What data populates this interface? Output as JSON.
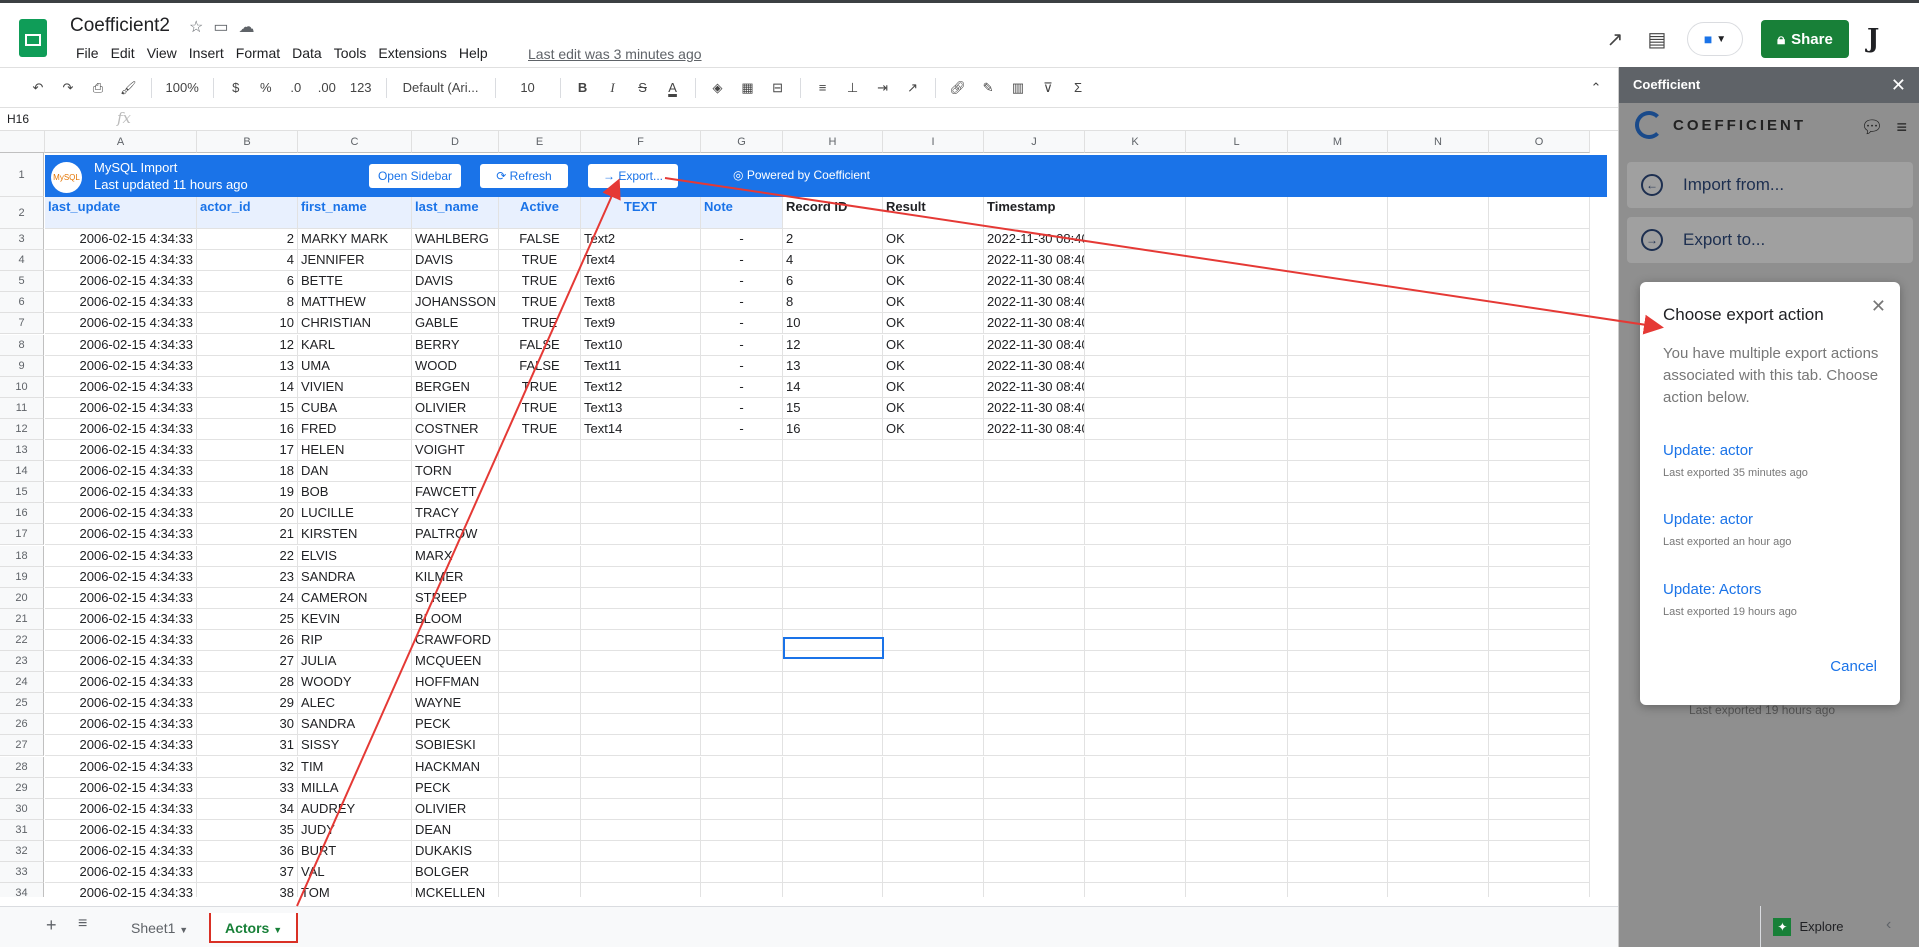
{
  "app": {
    "title": "Coefficient2",
    "menu": [
      "File",
      "Edit",
      "View",
      "Insert",
      "Format",
      "Data",
      "Tools",
      "Extensions",
      "Help"
    ],
    "last_edit": "Last edit was 3 minutes ago",
    "share_label": "Share",
    "avatar_letter": "J"
  },
  "toolbar": {
    "zoom": "100%",
    "currency": "$",
    "percent": "%",
    "dec_less": ".0",
    "dec_more": ".00",
    "format_more": "123",
    "font": "Default (Ari...",
    "font_size": "10",
    "bold": "B",
    "italic": "I",
    "strike": "S",
    "underline_a": "A"
  },
  "formula_bar": {
    "name_box": "H16",
    "fx": "fx"
  },
  "columns": [
    "A",
    "B",
    "C",
    "D",
    "E",
    "F",
    "G",
    "H",
    "I",
    "J",
    "K",
    "L",
    "M",
    "N",
    "O"
  ],
  "banner": {
    "logo_text": "MySQL",
    "title": "MySQL Import",
    "subtitle": "Last updated 11 hours ago",
    "open_sidebar": "Open Sidebar",
    "refresh": "Refresh",
    "export": "Export...",
    "powered": "Powered by Coefficient"
  },
  "headers": [
    "last_update",
    "actor_id",
    "first_name",
    "last_name",
    "Active",
    "TEXT",
    "Note",
    "Record ID",
    "Result",
    "Timestamp"
  ],
  "rows": [
    {
      "n": "3",
      "a": "2006-02-15 4:34:33",
      "b": "2",
      "c": "MARKY MARK",
      "d": "WAHLBERG",
      "e": "FALSE",
      "f": "Text2",
      "g": "-",
      "h": "2",
      "i": "OK",
      "j": "2022-11-30 08:40"
    },
    {
      "n": "4",
      "a": "2006-02-15 4:34:33",
      "b": "4",
      "c": "JENNIFER",
      "d": "DAVIS",
      "e": "TRUE",
      "f": "Text4",
      "g": "-",
      "h": "4",
      "i": "OK",
      "j": "2022-11-30 08:40"
    },
    {
      "n": "5",
      "a": "2006-02-15 4:34:33",
      "b": "6",
      "c": "BETTE",
      "d": "DAVIS",
      "e": "TRUE",
      "f": "Text6",
      "g": "-",
      "h": "6",
      "i": "OK",
      "j": "2022-11-30 08:40"
    },
    {
      "n": "6",
      "a": "2006-02-15 4:34:33",
      "b": "8",
      "c": "MATTHEW",
      "d": "JOHANSSON",
      "e": "TRUE",
      "f": "Text8",
      "g": "-",
      "h": "8",
      "i": "OK",
      "j": "2022-11-30 08:40"
    },
    {
      "n": "7",
      "a": "2006-02-15 4:34:33",
      "b": "10",
      "c": "CHRISTIAN",
      "d": "GABLE",
      "e": "TRUE",
      "f": "Text9",
      "g": "-",
      "h": "10",
      "i": "OK",
      "j": "2022-11-30 08:40"
    },
    {
      "n": "8",
      "a": "2006-02-15 4:34:33",
      "b": "12",
      "c": "KARL",
      "d": "BERRY",
      "e": "FALSE",
      "f": "Text10",
      "g": "-",
      "h": "12",
      "i": "OK",
      "j": "2022-11-30 08:40"
    },
    {
      "n": "9",
      "a": "2006-02-15 4:34:33",
      "b": "13",
      "c": "UMA",
      "d": "WOOD",
      "e": "FALSE",
      "f": "Text11",
      "g": "-",
      "h": "13",
      "i": "OK",
      "j": "2022-11-30 08:40"
    },
    {
      "n": "10",
      "a": "2006-02-15 4:34:33",
      "b": "14",
      "c": "VIVIEN",
      "d": "BERGEN",
      "e": "TRUE",
      "f": "Text12",
      "g": "-",
      "h": "14",
      "i": "OK",
      "j": "2022-11-30 08:40"
    },
    {
      "n": "11",
      "a": "2006-02-15 4:34:33",
      "b": "15",
      "c": "CUBA",
      "d": "OLIVIER",
      "e": "TRUE",
      "f": "Text13",
      "g": "-",
      "h": "15",
      "i": "OK",
      "j": "2022-11-30 08:40"
    },
    {
      "n": "12",
      "a": "2006-02-15 4:34:33",
      "b": "16",
      "c": "FRED",
      "d": "COSTNER",
      "e": "TRUE",
      "f": "Text14",
      "g": "-",
      "h": "16",
      "i": "OK",
      "j": "2022-11-30 08:40"
    },
    {
      "n": "13",
      "a": "2006-02-15 4:34:33",
      "b": "17",
      "c": "HELEN",
      "d": "VOIGHT"
    },
    {
      "n": "14",
      "a": "2006-02-15 4:34:33",
      "b": "18",
      "c": "DAN",
      "d": "TORN"
    },
    {
      "n": "15",
      "a": "2006-02-15 4:34:33",
      "b": "19",
      "c": "BOB",
      "d": "FAWCETT"
    },
    {
      "n": "16",
      "a": "2006-02-15 4:34:33",
      "b": "20",
      "c": "LUCILLE",
      "d": "TRACY"
    },
    {
      "n": "17",
      "a": "2006-02-15 4:34:33",
      "b": "21",
      "c": "KIRSTEN",
      "d": "PALTROW"
    },
    {
      "n": "18",
      "a": "2006-02-15 4:34:33",
      "b": "22",
      "c": "ELVIS",
      "d": "MARX"
    },
    {
      "n": "19",
      "a": "2006-02-15 4:34:33",
      "b": "23",
      "c": "SANDRA",
      "d": "KILMER"
    },
    {
      "n": "20",
      "a": "2006-02-15 4:34:33",
      "b": "24",
      "c": "CAMERON",
      "d": "STREEP"
    },
    {
      "n": "21",
      "a": "2006-02-15 4:34:33",
      "b": "25",
      "c": "KEVIN",
      "d": "BLOOM"
    },
    {
      "n": "22",
      "a": "2006-02-15 4:34:33",
      "b": "26",
      "c": "RIP",
      "d": "CRAWFORD"
    },
    {
      "n": "23",
      "a": "2006-02-15 4:34:33",
      "b": "27",
      "c": "JULIA",
      "d": "MCQUEEN"
    },
    {
      "n": "24",
      "a": "2006-02-15 4:34:33",
      "b": "28",
      "c": "WOODY",
      "d": "HOFFMAN"
    },
    {
      "n": "25",
      "a": "2006-02-15 4:34:33",
      "b": "29",
      "c": "ALEC",
      "d": "WAYNE"
    },
    {
      "n": "26",
      "a": "2006-02-15 4:34:33",
      "b": "30",
      "c": "SANDRA",
      "d": "PECK"
    },
    {
      "n": "27",
      "a": "2006-02-15 4:34:33",
      "b": "31",
      "c": "SISSY",
      "d": "SOBIESKI"
    },
    {
      "n": "28",
      "a": "2006-02-15 4:34:33",
      "b": "32",
      "c": "TIM",
      "d": "HACKMAN"
    },
    {
      "n": "29",
      "a": "2006-02-15 4:34:33",
      "b": "33",
      "c": "MILLA",
      "d": "PECK"
    },
    {
      "n": "30",
      "a": "2006-02-15 4:34:33",
      "b": "34",
      "c": "AUDREY",
      "d": "OLIVIER"
    },
    {
      "n": "31",
      "a": "2006-02-15 4:34:33",
      "b": "35",
      "c": "JUDY",
      "d": "DEAN"
    },
    {
      "n": "32",
      "a": "2006-02-15 4:34:33",
      "b": "36",
      "c": "BURT",
      "d": "DUKAKIS"
    },
    {
      "n": "33",
      "a": "2006-02-15 4:34:33",
      "b": "37",
      "c": "VAL",
      "d": "BOLGER"
    },
    {
      "n": "34",
      "a": "2006-02-15 4:34:33",
      "b": "38",
      "c": "TOM",
      "d": "MCKELLEN"
    }
  ],
  "sheets": {
    "sheet1": "Sheet1",
    "actors": "Actors",
    "explore": "Explore"
  },
  "sidebar": {
    "title": "Coefficient",
    "brand": "COEFFICIENT",
    "import_from": "Import from...",
    "export_to": "Export to...",
    "ghost_text": "Last exported 19 hours ago"
  },
  "modal": {
    "title": "Choose export action",
    "description": "You have multiple export actions associated with this tab. Choose action below.",
    "actions": [
      {
        "label": "Update: actor",
        "sub": "Last exported 35 minutes ago"
      },
      {
        "label": "Update: actor",
        "sub": "Last exported an hour ago"
      },
      {
        "label": "Update: Actors",
        "sub": "Last exported 19 hours ago"
      }
    ],
    "cancel": "Cancel"
  },
  "colors": {
    "accent": "#1a73e8",
    "share_green": "#188038",
    "arrow_red": "#e53935"
  }
}
